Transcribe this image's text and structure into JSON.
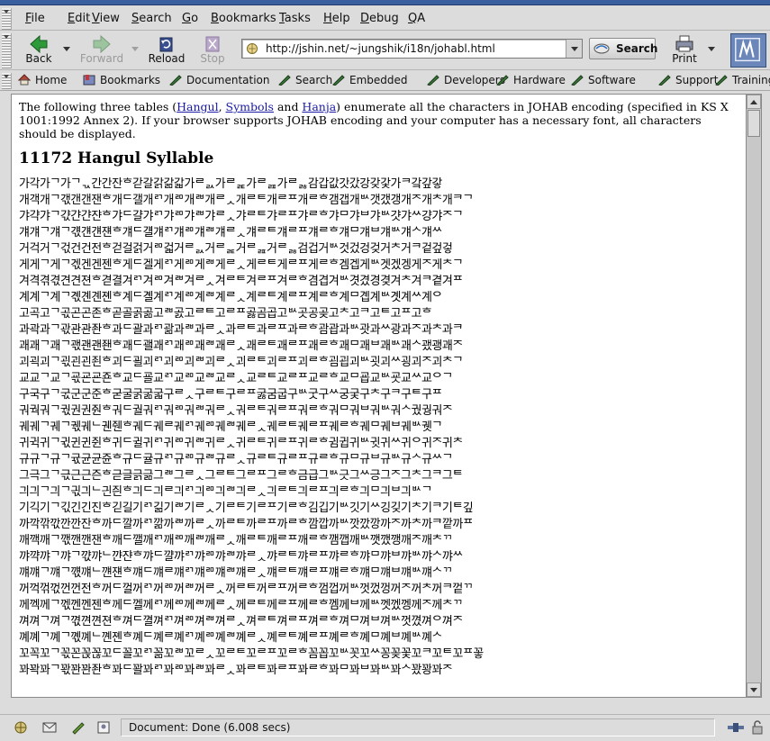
{
  "menu": [
    "File",
    "Edit",
    "View",
    "Search",
    "Go",
    "Bookmarks",
    "Tasks",
    "Help",
    "Debug",
    "QA"
  ],
  "menu_mnemonics": [
    "F",
    "E",
    "V",
    "S",
    "G",
    "B",
    "T",
    "H",
    "D",
    "Q"
  ],
  "nav": {
    "back_label": "Back",
    "forward_label": "Forward",
    "reload_label": "Reload",
    "stop_label": "Stop",
    "url": "http://jshin.net/~jungshik/i18n/johabl.html",
    "search_label": "Search",
    "print_label": "Print"
  },
  "personal_toolbar": [
    "Home",
    "Bookmarks",
    "Documentation",
    "Search",
    "Embedded",
    "Developers",
    "Hardware",
    "Software",
    "Support",
    "Training"
  ],
  "page": {
    "intro_1": "The following three tables (",
    "link_hangul": "Hangul",
    "intro_sep1": ", ",
    "link_symbols": "Symbols",
    "intro_sep2": " and ",
    "link_hanja": "Hanja",
    "intro_2": ") enumerate all the characters in JOHAB encoding (specified in KS X 1001:1992 Annex 2). If your browser supports JOHAB encoding and your computer has a necessary font, all characters should be displayed.",
    "heading": "11172 Hangul Syllable",
    "rows": [
      "가각가ᄀ가ᄀᆪ간간잔ᄒ갇갈갉갊갋가ᄅᆳ가ᄅᆴ가ᄅᆵ가ᄅᆶ감갑값갓갔강갖갗가ᄏ갘갚갛",
      "개객개ᄀ갟갠갠잰ᄒ개ᄃ갤개ᄅᄀ개ᄅᄆ개ᄅᄇ개ᄅᆺ개ᄅᄐ개ᄅᄑ개ᄅᄒ갬갭개ᄡ갯갰갱개ᄌ개ᄎ개ᄏᄀ",
      "갸갹갸ᄀ갻갼갼쟌ᄒ갸ᄃ걀갸ᄅᄀ갸ᄅᄆ갸ᄅᄇ갸ᄅᆺ갸ᄅᄐ갸ᄅᄑ갸ᄅᄒ갸ᄆ갸ᄇ갸ᄡ걋갸ᄊ걍갸ᄌᄀ",
      "걔걔ᄀ걔ᄀ걗걘걘쟨ᄒ걔ᄃ걜걔ᄅᄀ걔ᄅᄆ걔ᄅᄇ걔ᄅᆺ걔ᄅᄐ걔ᄅᄑ걔ᄅᄒ걔ᄆ걔ᄇ걔ᄡ걔ᄉ걔ᄊ",
      "거걱거ᄀ걳건건전ᄒ걷걸걹거ᄅᄆ걻거ᄅᆳ거ᄅᆴ거ᄅᆵ거ᄅᆶ검겁거ᄡ것겄겅겆거ᄎ거ᄏ겉겊겋",
      "게게ᄀ게ᄀ겏겐겐젠ᄒ게ᄃ겔게ᄅᄀ게ᄅᄆ게ᄅᄇ게ᄅᆺ게ᄅᄐ게ᄅᄑ게ᄅᄒ겜겝게ᄡ겟겠겡게ᄌ게ᄎᄀ",
      "겨격겪겫견견젼ᄒ겯결겨ᄅᄀ겨ᄅᄆ겨ᄅᄇ겨ᄅᆺ겨ᄅᄐ겨ᄅᄑ겨ᄅᄒ겸겹겨ᄡ겻겼경겾겨ᄎ겨ᄏ곁겨ᄑ",
      "계계ᄀ계ᄀ곇곈곈졘ᄒ계ᄃ곌계ᄅᄀ계ᄅᄆ계ᄅᄇ계ᄅᆺ계ᄅᄐ계ᄅᄑ계ᄅᄒ계ᄆ곕계ᄡ곗계ᄊ계ᄋ",
      "고곡고ᄀ곣곤곤존ᄒ곧골곩곪고ᄅᄇ곬고ᄅᄐ고ᄅᄑ곯곰곱고ᄡ곳공곶고ᄎ고ᄏ고ᄐ고ᄑ고ᄒ",
      "과곽과ᄀ곿관관좐ᄒ과ᄃ괄과ᄅᄀ괆과ᄅᄇ과ᄅᆺ과ᄅᄐ과ᄅᄑ과ᄅᄒ괌괍과ᄡ괏과ᄊ광과ᄌ과ᄎ과ᄏ",
      "괘괘ᄀ괘ᄀ괛괜괜좬ᄒ괘ᄃ괠괘ᄅᄀ괘ᄅᄆ괘ᄅᄇ괘ᄅᆺ괘ᄅᄐ괘ᄅᄑ괘ᄅᄒ괘ᄆ괘ᄇ괘ᄡ괘ᄉ괬괭괘ᄌ",
      "괴괵괴ᄀ괷괸괸죈ᄒ괴ᄃ괼괴ᄅᄀ괴ᄅᄆ괴ᄅᄇ괴ᄅᆺ괴ᄅᄐ괴ᄅᄑ괴ᄅᄒ굄굅괴ᄡ굇괴ᄊ굉괴ᄌ괴ᄎᄀ",
      "교교ᄀ교ᄀ굓굔굔죤ᄒ교ᄃ굘교ᄅᄀ교ᄅᄆ교ᄅᄇ교ᄅᆺ교ᄅᄐ교ᄅᄑ교ᄅᄒ교ᄆ굡교ᄡ굣교ᄊ교ᄋᄀ",
      "구국구ᄀ굯군군준ᄒ굳굴굵굶굷구ᄅᆺ구ᄅᄐ구ᄅᄑ굻굼굽구ᄡ굿구ᄊ궁궂구ᄎ구ᄏ구ᄐ구ᄑ",
      "궈궉궈ᄀ궋권권줜ᄒ궈ᄃ궐궈ᄅᄀ궈ᄅᄆ궈ᄅᄇ궈ᄅᆺ궈ᄅᄐ궈ᄅᄑ궈ᄅᄒ궈ᄆ궈ᄇ궈ᄡ궈ᄉ궜궝궈ᄌ",
      "궤궤ᄀ궤ᄀ궧궤ᄂ궨줸ᄒ궤ᄃ궤ᄅ궤ᄅᄀ궤ᄅᄆ궤ᄅᄇ궤ᄅᆺ궤ᄅᄐ궤ᄅᄑ궤ᄅᄒ궤ᄆ궤ᄇ궤ᄡ궷ᄀ",
      "귀귁귀ᄀ귃귄귄쥔ᄒ귀ᄃ귈귀ᄅᄀ귀ᄅᄆ귀ᄅᄇ귀ᄅᆺ귀ᄅᄐ귀ᄅᄑ귀ᄅᄒ귐귑귀ᄡ귓귀ᄊ귀ᄋ귀ᄌ귀ᄎ",
      "규규ᄀ규ᄀ귟균균쥰ᄒ규ᄃ귤규ᄅᄀ규ᄅᄆ규ᄅᄇ규ᄅᆺ규ᄅᄐ규ᄅᄑ규ᄅᄒ규ᄆ규ᄇ규ᄡ규ᄉ규ᄊᄀ",
      "그극그ᄀ귻근근즌ᄒ귿글긁긂그ᄅᄇ그ᄅᆺ그ᄅᄐ그ᄅᄑ그ᄅᄒ금급그ᄡ긋그ᄊ긍그ᄌ그ᄎ그ᄏ그ᄐ",
      "긔긔ᄀ긔ᄀ긗긔ᄂ긘즨ᄒ긔ᄃ긔ᄅ긔ᄅᄀ긔ᄅᄆ긔ᄅᄇ긔ᄅᆺ긔ᄅᄐ긔ᄅᄑ긔ᄅᄒ긔ᄆ긔ᄇ긔ᄡᄀ",
      "기긱기ᄀ긳긴긴진ᄒ긷길기ᄅᄀ긺기ᄅᄇ기ᄅᆺ기ᄅᄐ기ᄅᄑ기ᄅᄒ김깁기ᄡ깃기ᄊ깅깆기ᄎ기ᄏ기ᄐ깊",
      "까깍깎깏깐깐잔ᄒ까ᄃ깔까ᄅᄀ깖까ᄅᄇ까ᄅᆺ까ᄅᄐ까ᄅᄑ까ᄅᄒ깜깝까ᄡ깟깠깡까ᄌ까ᄎ까ᄏ깥까ᄑ",
      "깨깩깨ᄀ깫깬깬잰ᄒ깨ᄃ깰깨ᄅᄀ깨ᄅᄆ깨ᄅᄇ깨ᄅᆺ깨ᄅᄐ깨ᄅᄑ깨ᄅᄒ깸깹깨ᄡ깻깼깽깨ᄌ깨ᄎᄁ",
      "꺄꺅꺄ᄀ꺄ᄀ꺇꺄ᄂ꺈쟌ᄒ꺄ᄃ꺌꺄ᄅᄀ꺄ᄅᄆ꺄ᄅᄇ꺄ᄅᆺ꺄ᄅᄐ꺄ᄅᄑ꺄ᄅᄒ꺄ᄆ꺄ᄇ꺄ᄡ꺄ᄉ꺄ᄊ",
      "꺠꺠ᄀ꺠ᄀ꺣꺠ᄂ꺤쟨ᄒ꺠ᄃ꺠ᄅ꺠ᄅᄀ꺠ᄅᄆ꺠ᄅᄇ꺠ᄅᆺ꺠ᄅᄐ꺠ᄅᄑ꺠ᄅᄒ꺠ᄆ꺠ᄇ꺠ᄡ꺠ᄉᄁ",
      "꺼꺽꺾꺿껀껀전ᄒ꺼ᄃ껄꺼ᄅᄀ꺼ᄅᄆ꺼ᄅᄇ꺼ᄅᆺ꺼ᄅᄐ꺼ᄅᄑ꺼ᄅᄒ껌껍꺼ᄡ껏껐껑꺼ᄌ꺼ᄎ꺼ᄏ껕ᄁ",
      "께껙께ᄀ껛껜껜젠ᄒ께ᄃ껠께ᄅᄀ께ᄅᄆ께ᄅᄇ께ᄅᆺ께ᄅᄐ께ᄅᄑ께ᄅᄒ껨께ᄇ께ᄡ껫껬껭께ᄌ께ᄎᄁ",
      "껴껴ᄀ껴ᄀ껷껸껸젼ᄒ껴ᄃ껼껴ᄅᄀ껴ᄅᄆ껴ᄅᄇ껴ᄅᆺ껴ᄅᄐ껴ᄅᄑ껴ᄅᄒ껴ᄆ껴ᄇ껴ᄡ껏꼈껴ᄋ껴ᄌ",
      "꼐꼐ᄀ꼐ᄀ꼓꼐ᄂ꼔졘ᄒ꼐ᄃ꼐ᄅ꼐ᄅᄀ꼐ᄅᄆ꼐ᄅᄇ꼐ᄅᆺ꼐ᄅᄐ꼐ᄅᄑ꼐ᄅᄒ꼐ᄆ꼐ᄇ꼐ᄡ꼐ᄉ",
      "꼬꼭꼬ᄀ꼯꼰꼱꼲꼬ᄃ꼴꼬ᄅᄀ꼶꼬ᄅᄇ꼬ᄅᆺ꼬ᄅᄐ꼬ᄅᄑ꼬ᄅᄒ꼼꼽꼬ᄡ꼿꼬ᄊ꽁꽂꽃꼬ᄏ꼬ᄐ꼬ᄑ꽇",
      "꽈꽉꽈ᄀ꽋꽌꽌좐ᄒ꽈ᄃ꽐꽈ᄅᄀ꽈ᄅᄆ꽈ᄅᄇ꽈ᄅᆺ꽈ᄅᄐ꽈ᄅᄑ꽈ᄅᄒ꽈ᄆ꽈ᄇ꽈ᄡ꽈ᄉ꽜꽝꽈ᄌ"
    ]
  },
  "status": {
    "text": "Document: Done (6.008 secs)"
  },
  "colors": {
    "chrome": "#dcdcdc",
    "link": "#1a1aa6",
    "throbber": "#6b86b8"
  }
}
